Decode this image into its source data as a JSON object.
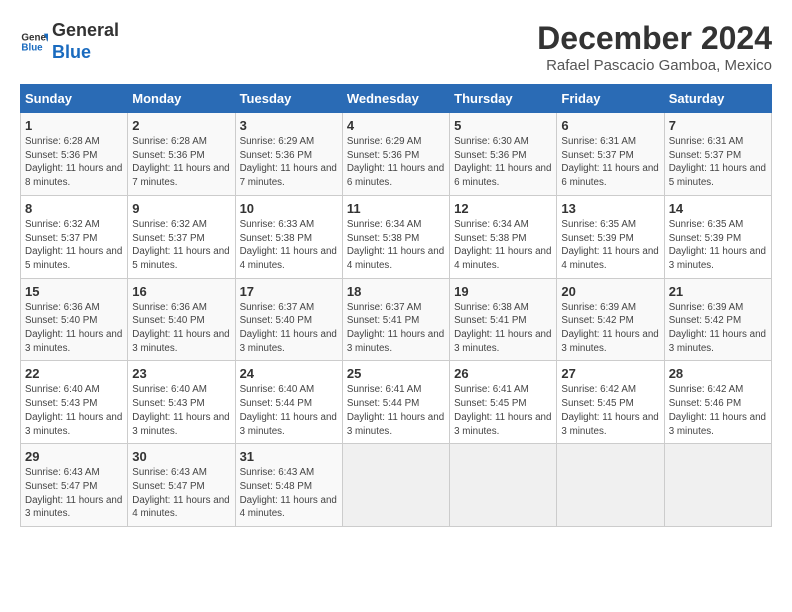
{
  "header": {
    "logo_text_general": "General",
    "logo_text_blue": "Blue",
    "month_title": "December 2024",
    "location": "Rafael Pascacio Gamboa, Mexico"
  },
  "weekdays": [
    "Sunday",
    "Monday",
    "Tuesday",
    "Wednesday",
    "Thursday",
    "Friday",
    "Saturday"
  ],
  "weeks": [
    [
      {
        "day": "1",
        "sunrise": "6:28 AM",
        "sunset": "5:36 PM",
        "daylight": "11 hours and 8 minutes."
      },
      {
        "day": "2",
        "sunrise": "6:28 AM",
        "sunset": "5:36 PM",
        "daylight": "11 hours and 7 minutes."
      },
      {
        "day": "3",
        "sunrise": "6:29 AM",
        "sunset": "5:36 PM",
        "daylight": "11 hours and 7 minutes."
      },
      {
        "day": "4",
        "sunrise": "6:29 AM",
        "sunset": "5:36 PM",
        "daylight": "11 hours and 6 minutes."
      },
      {
        "day": "5",
        "sunrise": "6:30 AM",
        "sunset": "5:36 PM",
        "daylight": "11 hours and 6 minutes."
      },
      {
        "day": "6",
        "sunrise": "6:31 AM",
        "sunset": "5:37 PM",
        "daylight": "11 hours and 6 minutes."
      },
      {
        "day": "7",
        "sunrise": "6:31 AM",
        "sunset": "5:37 PM",
        "daylight": "11 hours and 5 minutes."
      }
    ],
    [
      {
        "day": "8",
        "sunrise": "6:32 AM",
        "sunset": "5:37 PM",
        "daylight": "11 hours and 5 minutes."
      },
      {
        "day": "9",
        "sunrise": "6:32 AM",
        "sunset": "5:37 PM",
        "daylight": "11 hours and 5 minutes."
      },
      {
        "day": "10",
        "sunrise": "6:33 AM",
        "sunset": "5:38 PM",
        "daylight": "11 hours and 4 minutes."
      },
      {
        "day": "11",
        "sunrise": "6:34 AM",
        "sunset": "5:38 PM",
        "daylight": "11 hours and 4 minutes."
      },
      {
        "day": "12",
        "sunrise": "6:34 AM",
        "sunset": "5:38 PM",
        "daylight": "11 hours and 4 minutes."
      },
      {
        "day": "13",
        "sunrise": "6:35 AM",
        "sunset": "5:39 PM",
        "daylight": "11 hours and 4 minutes."
      },
      {
        "day": "14",
        "sunrise": "6:35 AM",
        "sunset": "5:39 PM",
        "daylight": "11 hours and 3 minutes."
      }
    ],
    [
      {
        "day": "15",
        "sunrise": "6:36 AM",
        "sunset": "5:40 PM",
        "daylight": "11 hours and 3 minutes."
      },
      {
        "day": "16",
        "sunrise": "6:36 AM",
        "sunset": "5:40 PM",
        "daylight": "11 hours and 3 minutes."
      },
      {
        "day": "17",
        "sunrise": "6:37 AM",
        "sunset": "5:40 PM",
        "daylight": "11 hours and 3 minutes."
      },
      {
        "day": "18",
        "sunrise": "6:37 AM",
        "sunset": "5:41 PM",
        "daylight": "11 hours and 3 minutes."
      },
      {
        "day": "19",
        "sunrise": "6:38 AM",
        "sunset": "5:41 PM",
        "daylight": "11 hours and 3 minutes."
      },
      {
        "day": "20",
        "sunrise": "6:39 AM",
        "sunset": "5:42 PM",
        "daylight": "11 hours and 3 minutes."
      },
      {
        "day": "21",
        "sunrise": "6:39 AM",
        "sunset": "5:42 PM",
        "daylight": "11 hours and 3 minutes."
      }
    ],
    [
      {
        "day": "22",
        "sunrise": "6:40 AM",
        "sunset": "5:43 PM",
        "daylight": "11 hours and 3 minutes."
      },
      {
        "day": "23",
        "sunrise": "6:40 AM",
        "sunset": "5:43 PM",
        "daylight": "11 hours and 3 minutes."
      },
      {
        "day": "24",
        "sunrise": "6:40 AM",
        "sunset": "5:44 PM",
        "daylight": "11 hours and 3 minutes."
      },
      {
        "day": "25",
        "sunrise": "6:41 AM",
        "sunset": "5:44 PM",
        "daylight": "11 hours and 3 minutes."
      },
      {
        "day": "26",
        "sunrise": "6:41 AM",
        "sunset": "5:45 PM",
        "daylight": "11 hours and 3 minutes."
      },
      {
        "day": "27",
        "sunrise": "6:42 AM",
        "sunset": "5:45 PM",
        "daylight": "11 hours and 3 minutes."
      },
      {
        "day": "28",
        "sunrise": "6:42 AM",
        "sunset": "5:46 PM",
        "daylight": "11 hours and 3 minutes."
      }
    ],
    [
      {
        "day": "29",
        "sunrise": "6:43 AM",
        "sunset": "5:47 PM",
        "daylight": "11 hours and 3 minutes."
      },
      {
        "day": "30",
        "sunrise": "6:43 AM",
        "sunset": "5:47 PM",
        "daylight": "11 hours and 4 minutes."
      },
      {
        "day": "31",
        "sunrise": "6:43 AM",
        "sunset": "5:48 PM",
        "daylight": "11 hours and 4 minutes."
      },
      null,
      null,
      null,
      null
    ]
  ]
}
